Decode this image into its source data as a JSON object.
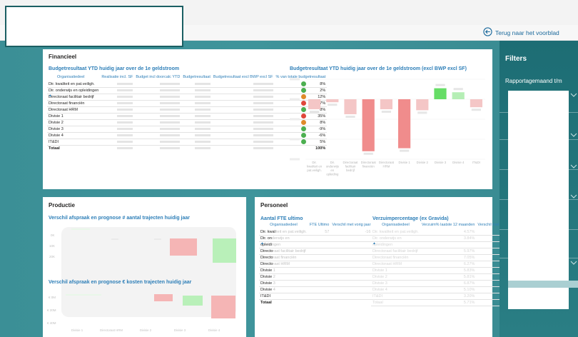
{
  "nav": {
    "back_label": "Terug naar het voorblad"
  },
  "filters": {
    "title": "Filters",
    "report_month_label": "Rapportagemaand t/m"
  },
  "financieel": {
    "title": "Financieel",
    "table_title": "Budgetresultaat YTD huidig jaar over de 1e geldstroom",
    "columns": [
      "Organisatiedeel",
      "Realisatie incl. SF",
      "Budget incl doorcalc YTD",
      "Budgetresultaat",
      "Budgetresultaat excl BWP excl SF",
      "% van totale budgetresultaat"
    ],
    "rows": [
      {
        "name": "Dir. kwaliteit en pat.veiligh.",
        "status": "green",
        "pct": "8%"
      },
      {
        "name": "Dir. onderwijs en opleidingen",
        "status": "green",
        "pct": "2%"
      },
      {
        "name": "Directoraat facilitair bedrijf",
        "status": "orange",
        "pct": "12%"
      },
      {
        "name": "Directoraat financiën",
        "status": "red",
        "pct": "37%"
      },
      {
        "name": "Directoraat HRM",
        "status": "green",
        "pct": "8%"
      },
      {
        "name": "Divisie 1",
        "status": "red",
        "pct": "35%"
      },
      {
        "name": "Divisie 2",
        "status": "orange",
        "pct": "8%"
      },
      {
        "name": "Divisie 3",
        "status": "green",
        "pct": "-9%"
      },
      {
        "name": "Divisie 4",
        "status": "green",
        "pct": "-6%"
      },
      {
        "name": "IT&DI",
        "status": "green",
        "pct": "5%"
      }
    ],
    "total": {
      "name": "Totaal",
      "pct": "100%"
    },
    "status_colors": {
      "green": "#4caf50",
      "orange": "#e08a2a",
      "red": "#e0463a"
    },
    "chart_title": "Budgetresultaat YTD huidig jaar over de 1e geldstroom (excl BWP excl SF)"
  },
  "chart_data": {
    "type": "bar",
    "title": "Budgetresultaat YTD huidig jaar over de 1e geldstroom (excl BWP excl SF)",
    "categories": [
      "Dir. kwaliteit en pat.veiligh.",
      "Dir. onderwijs en opleiding",
      "Directoraat facilitair bedrijf",
      "Directoraat financiën",
      "Directoraat HRM",
      "Divisie 1",
      "Divisie 2",
      "Divisie 3",
      "Divisie 4",
      "IT&DI"
    ],
    "category_labels": [
      [
        "Dir.",
        "kwaliteit en",
        "pat.veiligh."
      ],
      [
        "Dir.",
        "onderwijs",
        "en",
        "opleiding"
      ],
      [
        "Directoraat",
        "facilitair",
        "bedrijf"
      ],
      [
        "Directoraat",
        "financiën"
      ],
      [
        "Directoraat",
        "HRM"
      ],
      [
        "Divisie 1"
      ],
      [
        "Divisie 2"
      ],
      [
        "Divisie 3"
      ],
      [
        "Divisie 4"
      ],
      [
        "IT&DI"
      ]
    ],
    "values": [
      -0.5,
      -0.15,
      -0.75,
      -2.6,
      -0.5,
      -2.45,
      -0.55,
      0.55,
      0.35,
      -0.4
    ],
    "colors": [
      "#f4c6c6",
      "#f4c6c6",
      "#f4c6c6",
      "#f08c8c",
      "#f4c6c6",
      "#f08c8c",
      "#f4c6c6",
      "#66dd66",
      "#b5eeb5",
      "#f4c6c6"
    ],
    "ylim": [
      -3,
      1
    ]
  },
  "productie": {
    "title": "Productie",
    "sub1": "Verschil afspraak en prognose # aantal trajecten huidig jaar",
    "sub2": "Verschil afspraak en prognose € kosten trajecten huidig jaar",
    "mini_axis1": [
      "0K",
      "10K",
      "20K"
    ],
    "mini_axis2": [
      "€ 0M",
      "€ 20M",
      "€ 40M"
    ],
    "mini_xlabels": [
      "Divisie 1",
      "Directoraat HRM",
      "Divisie 2",
      "Divisie 3",
      "Divisie 4"
    ]
  },
  "personeel": {
    "title": "Personeel",
    "fte_title": "Aantal FTE ultimo",
    "fte_columns": [
      "Organisatiedeel",
      "FTE Ultimo",
      "Verschil met vorig jaar"
    ],
    "fte_rows": [
      [
        "Dir. kwal",
        "iteit en pat.veiligh.",
        "57",
        "-16"
      ],
      [
        "Dir. on",
        "derwijs en",
        "",
        ""
      ],
      [
        "opleidi",
        "ngen",
        "",
        ""
      ],
      [
        "Directo",
        "raat facilitair bedrijf",
        "",
        ""
      ],
      [
        "Directo",
        "raat financiën",
        "",
        ""
      ],
      [
        "Directo",
        "raat HRM",
        "",
        ""
      ],
      [
        "Divisie",
        " 1",
        "",
        ""
      ],
      [
        "Divisie",
        " 2",
        "",
        ""
      ],
      [
        "Divisie",
        " 3",
        "",
        ""
      ],
      [
        "Divisie",
        " 4",
        "",
        ""
      ],
      [
        "IT&DI",
        "",
        "",
        ""
      ]
    ],
    "fte_total": "Totaal",
    "verzuim_title": "Verzuimpercentage (ex Gravida)",
    "verzuim_columns": [
      "Organisatiedeel",
      "Verzuim% laatste 12 maanden",
      "Verschil met vorig jaar"
    ],
    "verzuim_rows": [
      [
        "Dir. kwaliteit en pat.veiligh.",
        "4.57%",
        "-0.34%"
      ],
      [
        "Dir. onderwijs en",
        "3.84%",
        "-0.21%"
      ],
      [
        "opleidingen",
        "",
        ""
      ],
      [
        "Directoraat facilitair bedrijf",
        "5.97%",
        "0.53%"
      ],
      [
        "Directoraat financiën",
        "7.05%",
        "0.34%"
      ],
      [
        "Directoraat HRM",
        "6.27%",
        "0.72%"
      ],
      [
        "Divisie 1",
        "5.83%",
        "0.68%"
      ],
      [
        "Divisie 2",
        "5.81%",
        "0.04%"
      ],
      [
        "Divisie 3",
        "6.87%",
        "0.30%"
      ],
      [
        "Divisie 4",
        "5.10%",
        "0.36%"
      ],
      [
        "IT&DI",
        "3.20%",
        "-0.84%"
      ],
      [
        "Totaal",
        "5.71%",
        "0.22%"
      ]
    ]
  }
}
